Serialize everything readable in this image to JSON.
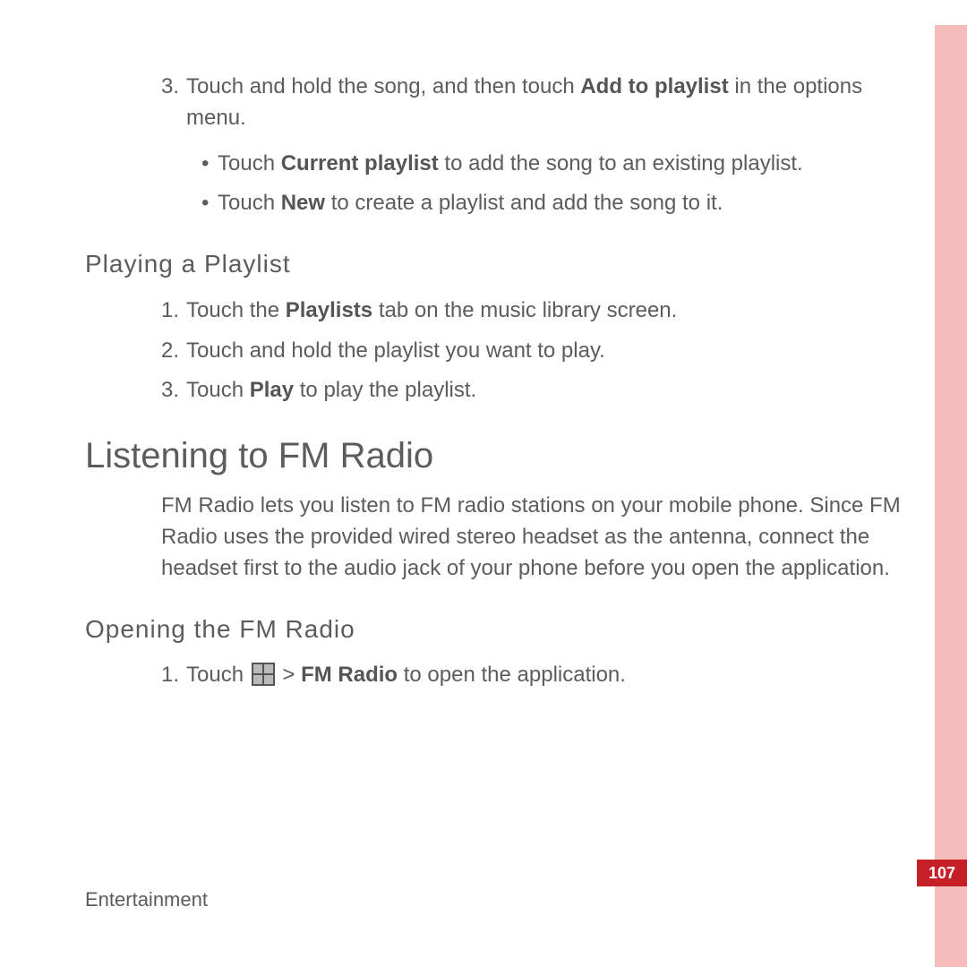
{
  "top_block": {
    "step3": {
      "num": "3.",
      "pre": "Touch and hold the song, and then touch ",
      "bold": "Add to playlist",
      "post": " in the options menu."
    },
    "bullets": [
      {
        "pre": "Touch ",
        "bold": "Current playlist",
        "post": " to add the song to an existing playlist."
      },
      {
        "pre": "Touch ",
        "bold": "New",
        "post": " to create a playlist and add the song to it."
      }
    ],
    "bullet_dot": "•"
  },
  "playlist": {
    "heading": "Playing  a  Playlist",
    "steps": [
      {
        "num": "1.",
        "pre": "Touch the ",
        "bold": "Playlists",
        "post": " tab on the music library screen."
      },
      {
        "num": "2.",
        "pre": "Touch and hold the playlist you want to play.",
        "bold": "",
        "post": ""
      },
      {
        "num": "3.",
        "pre": "Touch ",
        "bold": "Play",
        "post": " to play the playlist."
      }
    ]
  },
  "fm": {
    "heading": "Listening to FM Radio",
    "intro": "FM Radio lets you listen to FM radio stations on your mobile phone. Since FM Radio uses the provided wired stereo headset as the antenna, connect the headset first to the audio jack of your phone before you open the application.",
    "open_heading": "Opening  the  FM  Radio",
    "step1": {
      "num": "1.",
      "pre": "Touch ",
      "sep": "  >  ",
      "bold": "FM Radio",
      "post": " to open the application."
    }
  },
  "footer": {
    "section": "Entertainment",
    "page": "107"
  }
}
